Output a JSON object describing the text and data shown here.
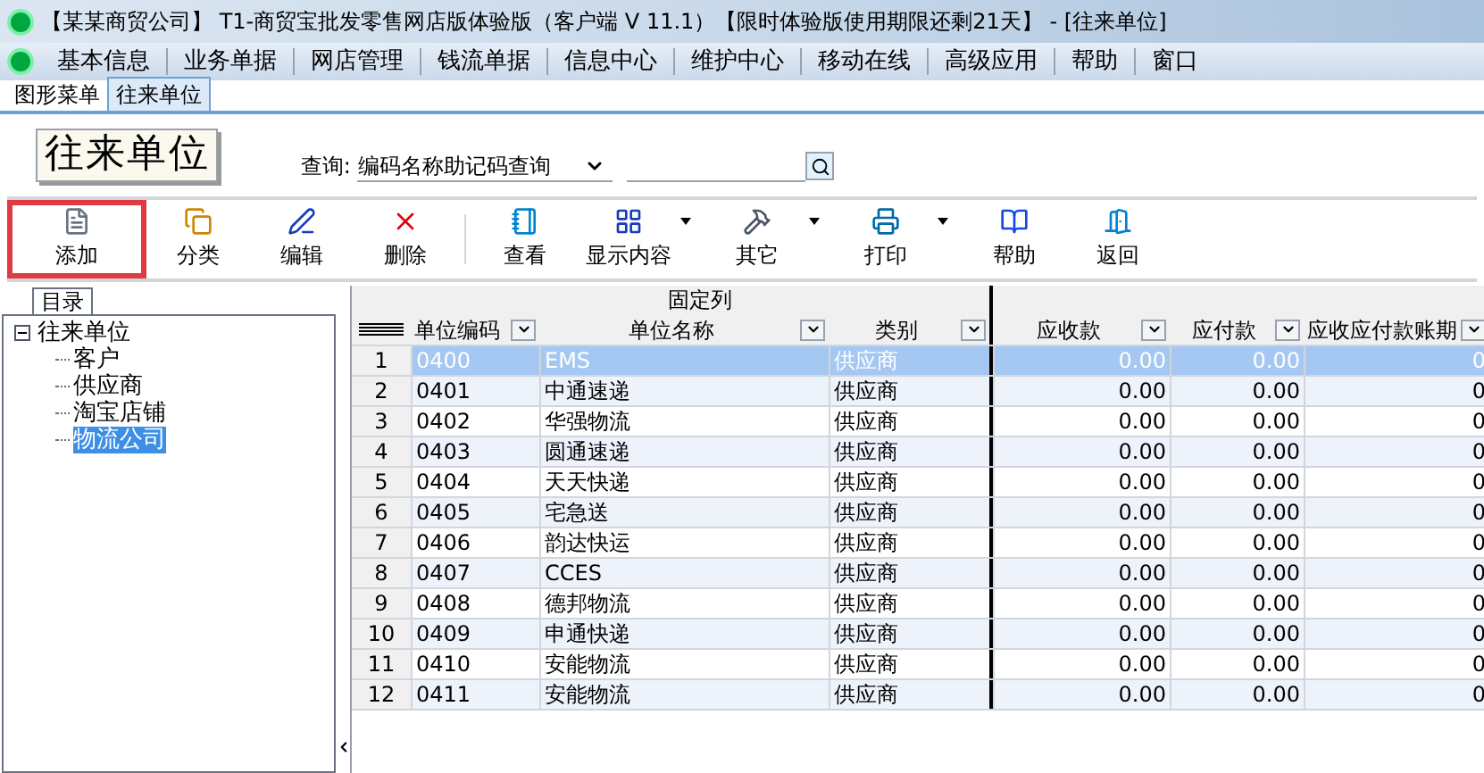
{
  "window": {
    "title": "【某某商贸公司】 T1-商贸宝批发零售网店版体验版（客户端 V 11.1）【限时体验版使用期限还剩21天】 - [往来单位]"
  },
  "menu": [
    "基本信息",
    "业务单据",
    "网店管理",
    "钱流单据",
    "信息中心",
    "维护中心",
    "移动在线",
    "高级应用",
    "帮助",
    "窗口"
  ],
  "tabs": [
    {
      "label": "图形菜单",
      "selected": false
    },
    {
      "label": "往来单位",
      "selected": true
    }
  ],
  "page_title": "往来单位",
  "query": {
    "label": "查询:",
    "mode": "编码名称助记码查询"
  },
  "toolbar": [
    {
      "label": "添加",
      "highlighted": true,
      "dropdown": false
    },
    {
      "label": "分类",
      "highlighted": false,
      "dropdown": false
    },
    {
      "label": "编辑",
      "highlighted": false,
      "dropdown": false
    },
    {
      "label": "删除",
      "highlighted": false,
      "dropdown": false
    },
    {
      "label": "查看",
      "highlighted": false,
      "dropdown": false
    },
    {
      "label": "显示内容",
      "highlighted": false,
      "dropdown": true
    },
    {
      "label": "其它",
      "highlighted": false,
      "dropdown": true
    },
    {
      "label": "打印",
      "highlighted": false,
      "dropdown": true
    },
    {
      "label": "帮助",
      "highlighted": false,
      "dropdown": false
    },
    {
      "label": "返回",
      "highlighted": false,
      "dropdown": false
    }
  ],
  "tree": {
    "tab": "目录",
    "root": {
      "label": "往来单位",
      "expanded": true,
      "children": [
        {
          "label": "客户",
          "selected": false
        },
        {
          "label": "供应商",
          "selected": false
        },
        {
          "label": "淘宝店铺",
          "selected": false
        },
        {
          "label": "物流公司",
          "selected": true
        }
      ]
    }
  },
  "table": {
    "group_header": "固定列",
    "columns": [
      "单位编码",
      "单位名称",
      "类别",
      "应收款",
      "应付款",
      "应收应付款账期"
    ],
    "rows": [
      {
        "index": "1",
        "cells": [
          "0400",
          "EMS",
          "供应商",
          "0.00",
          "0.00",
          "0"
        ],
        "selected": true
      },
      {
        "index": "2",
        "cells": [
          "0401",
          "中通速递",
          "供应商",
          "0.00",
          "0.00",
          "0"
        ],
        "selected": false
      },
      {
        "index": "3",
        "cells": [
          "0402",
          "华强物流",
          "供应商",
          "0.00",
          "0.00",
          "0"
        ],
        "selected": false
      },
      {
        "index": "4",
        "cells": [
          "0403",
          "圆通速递",
          "供应商",
          "0.00",
          "0.00",
          "0"
        ],
        "selected": false
      },
      {
        "index": "5",
        "cells": [
          "0404",
          "天天快递",
          "供应商",
          "0.00",
          "0.00",
          "0"
        ],
        "selected": false
      },
      {
        "index": "6",
        "cells": [
          "0405",
          "宅急送",
          "供应商",
          "0.00",
          "0.00",
          "0"
        ],
        "selected": false
      },
      {
        "index": "7",
        "cells": [
          "0406",
          "韵达快运",
          "供应商",
          "0.00",
          "0.00",
          "0"
        ],
        "selected": false
      },
      {
        "index": "8",
        "cells": [
          "0407",
          "CCES",
          "供应商",
          "0.00",
          "0.00",
          "0"
        ],
        "selected": false
      },
      {
        "index": "9",
        "cells": [
          "0408",
          "德邦物流",
          "供应商",
          "0.00",
          "0.00",
          "0"
        ],
        "selected": false
      },
      {
        "index": "10",
        "cells": [
          "0409",
          "申通快递",
          "供应商",
          "0.00",
          "0.00",
          "0"
        ],
        "selected": false
      },
      {
        "index": "11",
        "cells": [
          "0410",
          "安能物流",
          "供应商",
          "0.00",
          "0.00",
          "0"
        ],
        "selected": false
      },
      {
        "index": "12",
        "cells": [
          "0411",
          "安能物流",
          "供应商",
          "0.00",
          "0.00",
          "0"
        ],
        "selected": false
      }
    ]
  }
}
